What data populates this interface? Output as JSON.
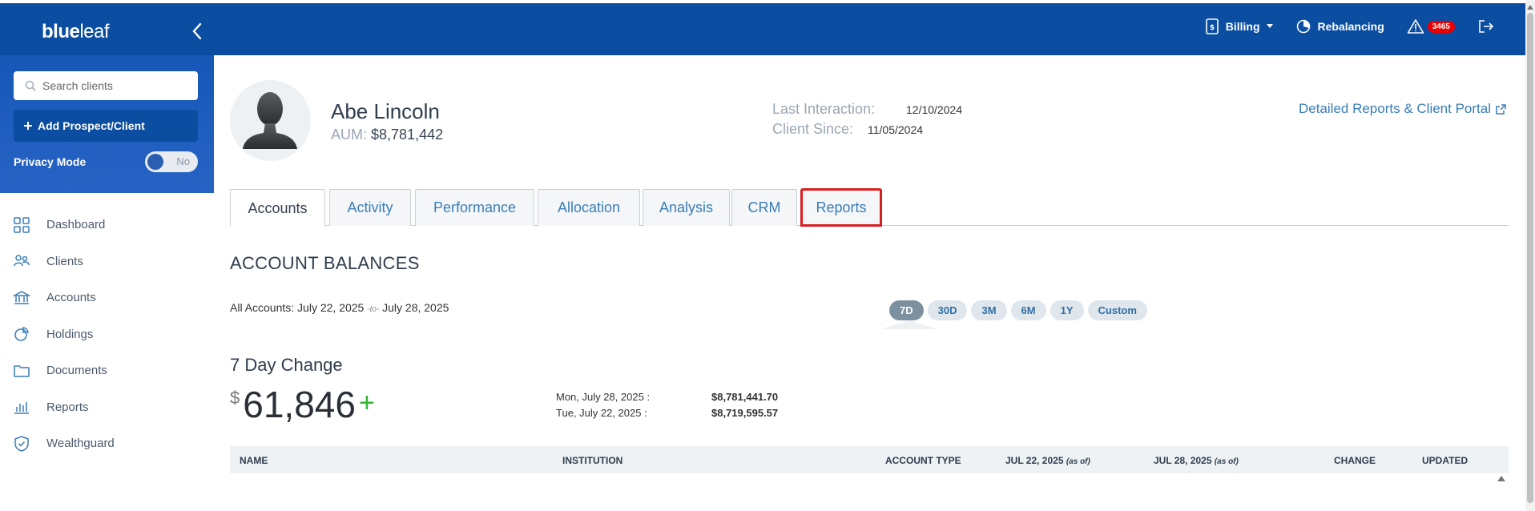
{
  "brand": {
    "logo_bold": "blue",
    "logo_light": "leaf"
  },
  "topbar": {
    "billing_label": "Billing",
    "rebalancing_label": "Rebalancing",
    "alert_count": "3465"
  },
  "sidebar": {
    "search_placeholder": "Search clients",
    "add_label": "Add Prospect/Client",
    "privacy_label": "Privacy Mode",
    "privacy_toggle": "No",
    "items": [
      {
        "label": "Dashboard",
        "icon": "dashboard-icon"
      },
      {
        "label": "Clients",
        "icon": "clients-icon"
      },
      {
        "label": "Accounts",
        "icon": "bank-icon"
      },
      {
        "label": "Holdings",
        "icon": "pie-chart-icon"
      },
      {
        "label": "Documents",
        "icon": "folder-icon"
      },
      {
        "label": "Reports",
        "icon": "bar-chart-icon"
      },
      {
        "label": "Wealthguard",
        "icon": "shield-icon"
      }
    ]
  },
  "client": {
    "name": "Abe Lincoln",
    "aum_label": "AUM:",
    "aum_value": "$8,781,442",
    "last_interaction_label": "Last Interaction:",
    "last_interaction_value": "12/10/2024",
    "client_since_label": "Client Since:",
    "client_since_value": "11/05/2024",
    "portal_link": "Detailed Reports & Client Portal"
  },
  "tabs": [
    "Accounts",
    "Activity",
    "Performance",
    "Allocation",
    "Analysis",
    "CRM",
    "Reports"
  ],
  "balances": {
    "title": "ACCOUNT BALANCES",
    "range_prefix": "All Accounts:",
    "range_start": "July 22, 2025",
    "range_to": "-to-",
    "range_end": "July 28, 2025",
    "periods": [
      "7D",
      "30D",
      "3M",
      "6M",
      "1Y",
      "Custom"
    ],
    "active_period": "7D"
  },
  "change": {
    "title": "7 Day Change",
    "currency": "$",
    "amount": "61,846",
    "sign": "+",
    "rows": [
      {
        "date": "Mon, July 28, 2025 :",
        "value": "$8,781,441.70"
      },
      {
        "date": "Tue, July 22, 2025 :",
        "value": "$8,719,595.57"
      }
    ]
  },
  "table": {
    "headers": {
      "name": "NAME",
      "institution": "INSTITUTION",
      "account_type": "ACCOUNT TYPE",
      "jul22": "JUL 22, 2025",
      "jul28": "JUL 28, 2025",
      "asof": "(as of)",
      "change": "CHANGE",
      "updated": "UPDATED"
    }
  }
}
